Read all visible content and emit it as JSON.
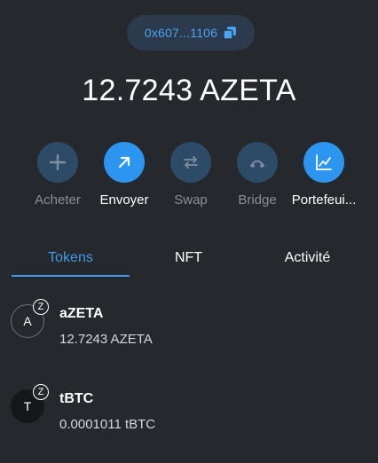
{
  "wallet": {
    "address_short": "0x607...1106",
    "balance": "12.7243 AZETA"
  },
  "actions": [
    {
      "label": "Acheter",
      "icon": "plus-icon",
      "state": "muted"
    },
    {
      "label": "Envoyer",
      "icon": "send-arrow-icon",
      "state": "active"
    },
    {
      "label": "Swap",
      "icon": "swap-arrows-icon",
      "state": "muted"
    },
    {
      "label": "Bridge",
      "icon": "bridge-icon",
      "state": "muted"
    },
    {
      "label": "Portefeui...",
      "icon": "chart-icon",
      "state": "active"
    }
  ],
  "tabs": [
    {
      "label": "Tokens",
      "active": true
    },
    {
      "label": "NFT",
      "active": false
    },
    {
      "label": "Activité",
      "active": false
    }
  ],
  "tokens": [
    {
      "avatar_letter": "A",
      "badge": "Z",
      "name": "aZETA",
      "amount": "12.7243 AZETA"
    },
    {
      "avatar_letter": "T",
      "badge": "Z",
      "name": "tBTC",
      "amount": "0.0001011 tBTC"
    }
  ],
  "colors": {
    "background": "#25282d",
    "accent": "#2b95f0",
    "muted_button": "#2d4a66",
    "muted_label": "#8a8f96"
  }
}
